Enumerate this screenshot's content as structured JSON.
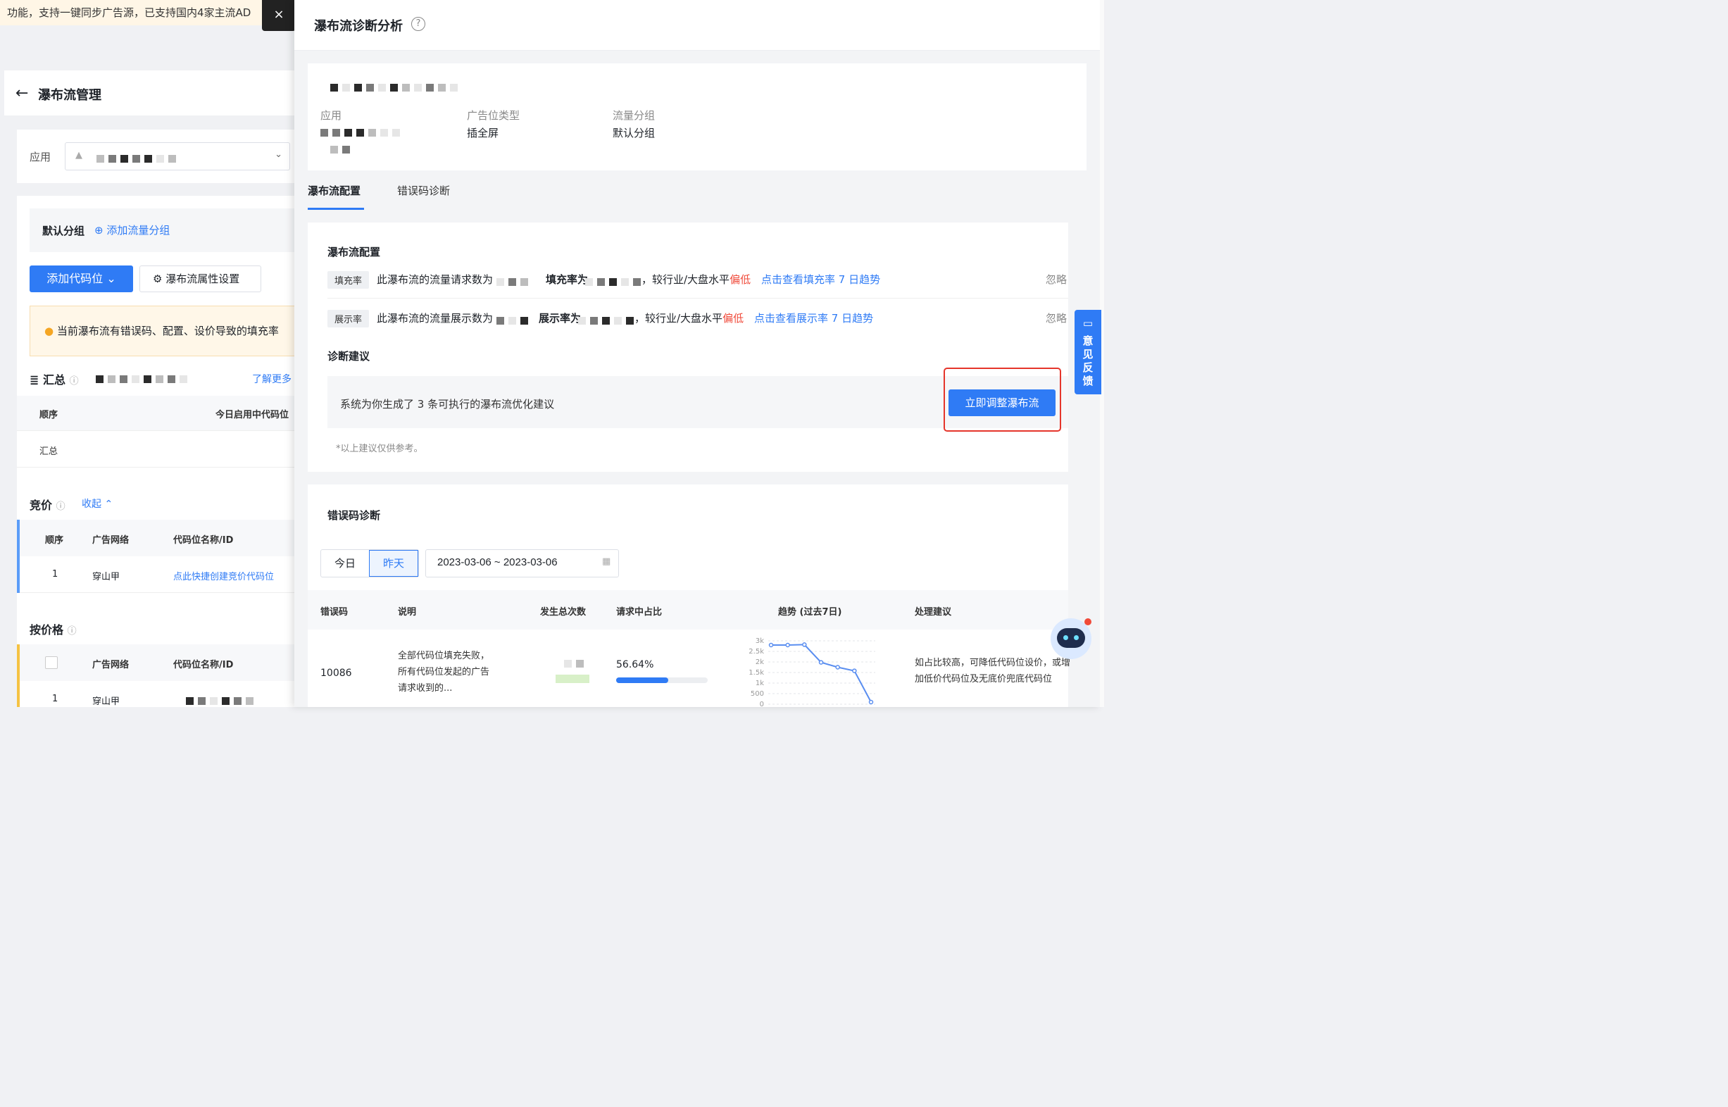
{
  "banner": {
    "text": "功能，支持一键同步广告源，已支持国内4家主流AD",
    "close": "×"
  },
  "left": {
    "title": "瀑布流管理",
    "app_label": "应用",
    "group_label": "默认分组",
    "add_group": "添加流量分组",
    "add_code_btn": "添加代码位",
    "settings_btn": "瀑布流属性设置",
    "warning": "当前瀑布流有错误码、配置、设价导致的填充率",
    "summary_label": "汇总",
    "learn_more": "了解更多",
    "summary_table": {
      "col1": "顺序",
      "col2": "今日启用中代码位",
      "row1": "汇总"
    },
    "bidding": {
      "label": "竞价",
      "collapse": "收起",
      "cols": [
        "顺序",
        "广告网络",
        "代码位名称/ID"
      ],
      "row": {
        "order": "1",
        "network": "穿山甲",
        "link": "点此快捷创建竞价代码位"
      }
    },
    "pricing": {
      "label": "按价格",
      "cols": [
        "广告网络",
        "代码位名称/ID"
      ],
      "row": {
        "order": "1",
        "network": "穿山甲"
      }
    }
  },
  "panel": {
    "title": "瀑布流诊断分析",
    "info": {
      "app_label": "应用",
      "ad_type_label": "广告位类型",
      "ad_type_value": "插全屏",
      "group_label": "流量分组",
      "group_value": "默认分组"
    },
    "tabs": [
      {
        "label": "瀑布流配置",
        "active": true
      },
      {
        "label": "错误码诊断",
        "active": false
      }
    ],
    "config": {
      "title": "瀑布流配置",
      "rows": [
        {
          "tag": "填充率",
          "text1": "此瀑布流的流量请求数为",
          "text2": "填充率为",
          "text3": "，较行业/大盘水平",
          "status": "偏低",
          "link": "点击查看填充率 7 日趋势",
          "ignore": "忽略"
        },
        {
          "tag": "展示率",
          "text1": "此瀑布流的流量展示数为",
          "text2": "展示率为",
          "text3": "，较行业/大盘水平",
          "status": "偏低",
          "link": "点击查看展示率 7 日趋势",
          "ignore": "忽略"
        }
      ],
      "advice_title": "诊断建议",
      "advice_text": "系统为你生成了 3 条可执行的瀑布流优化建议",
      "advice_button": "立即调整瀑布流",
      "note": "*以上建议仅供参考。"
    },
    "errors": {
      "title": "错误码诊断",
      "date_tabs": [
        "今日",
        "昨天"
      ],
      "date_range": "2023-03-06 ~ 2023-03-06",
      "columns": [
        "错误码",
        "说明",
        "发生总次数",
        "请求中占比",
        "趋势 (过去7日)",
        "处理建议"
      ],
      "row": {
        "code": "10086",
        "desc": "全部代码位填充失败，所有代码位发起的广告请求收到的...",
        "ratio": "56.64%",
        "ratio_value": 0.5664,
        "advice": "如占比较高，可降低代码位设价，或增加低价代码位及无底价兜底代码位"
      },
      "trend_ticks": [
        "3k",
        "2.5k",
        "2k",
        "1.5k",
        "1k",
        "500",
        "0"
      ],
      "trend_values": [
        2800,
        2800,
        2820,
        1980,
        1750,
        1580,
        100
      ]
    }
  },
  "feedback": "意见反馈",
  "colors": {
    "primary": "#2f7bf5",
    "danger": "#f04a3a",
    "highlight": "#e5352b"
  }
}
